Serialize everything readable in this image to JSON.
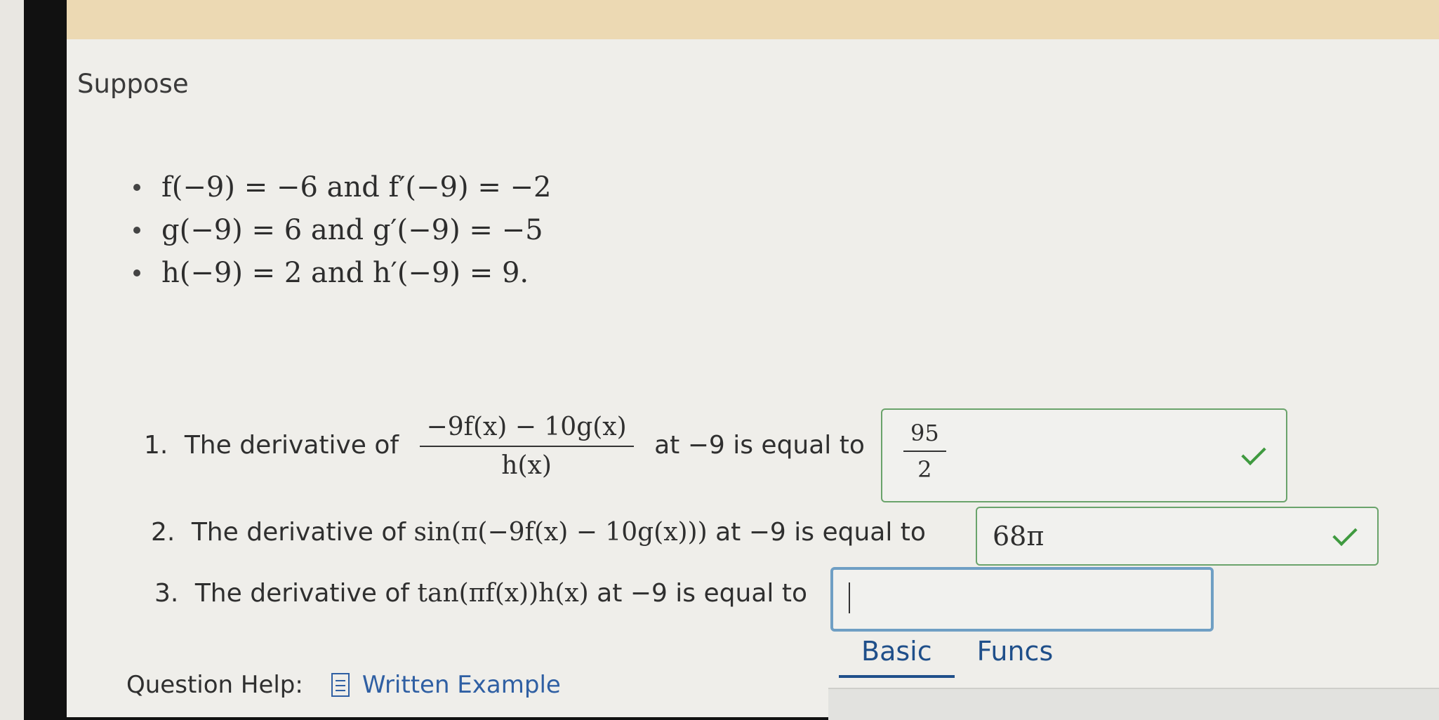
{
  "intro": "Suppose",
  "given": [
    {
      "text": "f(−9) = −6 and f′(−9) = −2"
    },
    {
      "text": "g(−9) = 6 and g′(−9) = −5"
    },
    {
      "text": "h(−9) = 2 and h′(−9) = 9."
    }
  ],
  "questions": [
    {
      "number": "1.",
      "prefix": "The derivative of",
      "expr_num": "−9f(x) − 10g(x)",
      "expr_den": "h(x)",
      "suffix": "at −9 is equal to",
      "answer_num": "95",
      "answer_den": "2",
      "status": "correct"
    },
    {
      "number": "2.",
      "prefix": "The derivative of",
      "expr": "sin(π(−9f(x) − 10g(x)))",
      "suffix": "at −9 is equal to",
      "answer": "68π",
      "status": "correct"
    },
    {
      "number": "3.",
      "prefix": "The derivative of",
      "expr": "tan(πf(x))h(x)",
      "suffix": "at −9 is equal to",
      "answer": "",
      "status": "active"
    }
  ],
  "tabs": [
    "Basic",
    "Funcs"
  ],
  "help": {
    "label": "Question Help:",
    "link": "Written Example"
  }
}
